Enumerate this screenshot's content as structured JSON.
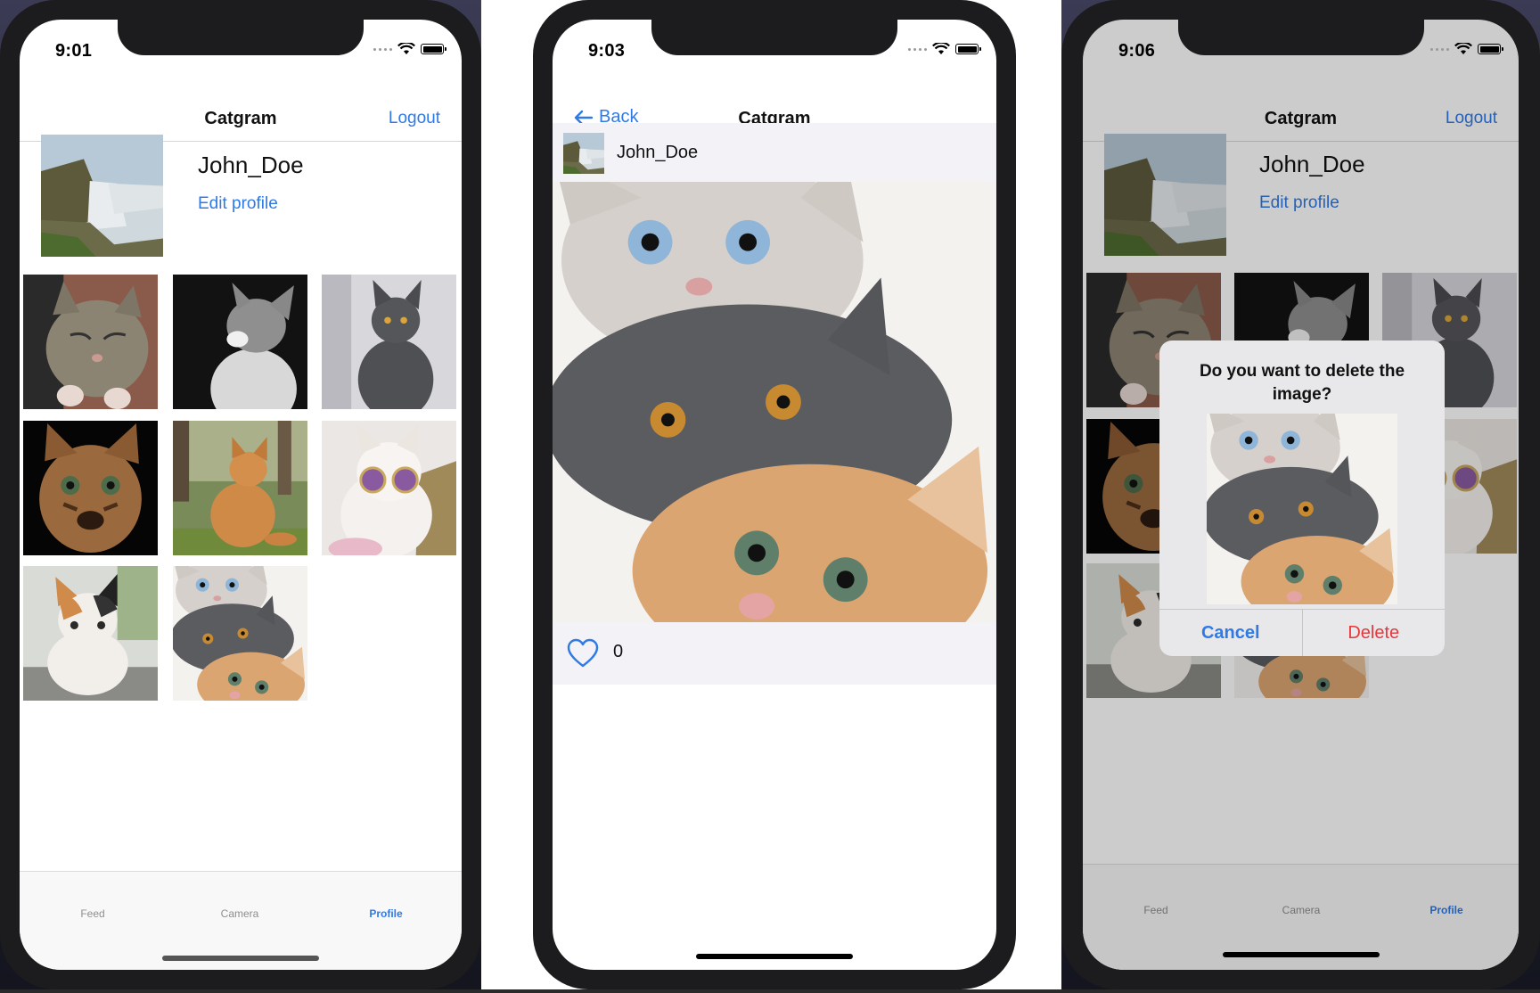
{
  "colors": {
    "accent": "#2f7ae5",
    "destructive": "#e5383b",
    "phone_frame": "#1c1c1e"
  },
  "screens": [
    {
      "time": "9:01",
      "nav": {
        "title": "Catgram",
        "right": "Logout"
      },
      "profile": {
        "username": "John_Doe",
        "edit": "Edit profile"
      },
      "tabs": [
        "Feed",
        "Camera",
        "Profile"
      ],
      "active_tab": "Profile"
    },
    {
      "time": "9:03",
      "nav": {
        "title": "Catgram",
        "back": "Back"
      },
      "post": {
        "username": "John_Doe",
        "likes": "0"
      }
    },
    {
      "time": "9:06",
      "nav": {
        "title": "Catgram",
        "right": "Logout"
      },
      "profile": {
        "username": "John_Doe",
        "edit": "Edit profile"
      },
      "alert": {
        "message": "Do you want to delete the image?",
        "cancel": "Cancel",
        "delete": "Delete"
      },
      "tabs": [
        "Feed",
        "Camera",
        "Profile"
      ],
      "active_tab": "Profile"
    }
  ],
  "icons": [
    "back-arrow-icon",
    "heart-icon",
    "wifi-icon",
    "battery-icon",
    "signal-icon"
  ]
}
